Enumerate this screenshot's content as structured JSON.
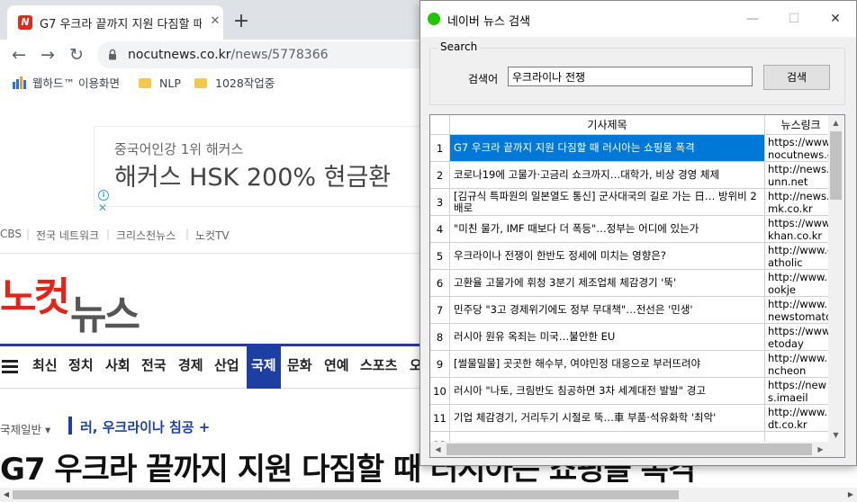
{
  "browser": {
    "tab_title": "G7 우크라 끝까지 지원 다짐할 때",
    "tab_close": "✕",
    "new_tab": "+",
    "favicon_letter": "N",
    "url_host": "nocutnews.co.kr",
    "url_path": "/news/5778366",
    "nav": {
      "back": "←",
      "forward": "→",
      "reload": "↻"
    },
    "bookmarks": [
      {
        "label": "웹하드™ 이용화면",
        "icon": "webhard-icon"
      },
      {
        "label": "NLP",
        "icon": "folder-icon"
      },
      {
        "label": "1028작업중",
        "icon": "folder-icon"
      }
    ]
  },
  "page": {
    "ad_line1": "중국어인강 1위 해커스",
    "ad_line2": "해커스 HSK 200% 현금환",
    "ad_info": "i",
    "ad_close": "✕",
    "topnav": [
      "CBS",
      "전국 네트워크",
      "크리스천뉴스",
      "노컷TV"
    ],
    "logo_part1": "노컷",
    "logo_part2": "뉴스",
    "menu": [
      "최신",
      "정치",
      "사회",
      "전국",
      "경제",
      "산업",
      "국제",
      "문화",
      "연예",
      "스포츠",
      "오"
    ],
    "menu_active": "국제",
    "breadcrumb_section": "국제일반 ▾",
    "breadcrumb_topic": "러, 우크라이나 침공 +",
    "headline": "G7 우크라 끝까지 지원 다짐할 때 러시아는 쇼핑몰 폭격"
  },
  "dialog": {
    "title": "네이버 뉴스 검색",
    "window_buttons": {
      "minimize": "—",
      "maximize": "☐",
      "close": "✕"
    },
    "group_label": "Search",
    "search_label": "검색어",
    "search_value": "우크라이나 전쟁",
    "search_button": "검색",
    "grid": {
      "columns": [
        "기사제목",
        "뉴스링크"
      ],
      "rows": [
        {
          "num": "1",
          "title": "G7 우크라 끝까지 지원 다짐할 때 러시아는 쇼핑몰 폭격",
          "link": "https://www.nocutnews.co.kr",
          "selected": true
        },
        {
          "num": "2",
          "title": "코로나19에 고물가·고금리 쇼크까지…대학가, 비상 경영 체제",
          "link": "http://news.unn.net",
          "selected": false
        },
        {
          "num": "3",
          "title": "[김규식 특파원의 일본열도 통신] 군사대국의 길로 가는 日… 방위비 2배로",
          "link": "http://news.mk.co.kr",
          "selected": false
        },
        {
          "num": "4",
          "title": "\"미친 물가, IMF 때보다 더 폭등\"…정부는 어디에 있는가",
          "link": "https://www.khan.co.kr",
          "selected": false
        },
        {
          "num": "5",
          "title": "우크라이나 전쟁이 한반도 정세에 미치는 영향은?",
          "link": "http://www.catholic",
          "selected": false
        },
        {
          "num": "6",
          "title": "고환율 고물가에 휘청 3분기 제조업체 체감경기 '뚝'",
          "link": "http://www.kookje",
          "selected": false
        },
        {
          "num": "7",
          "title": "민주당 \"3고 경제위기에도 정부 무대책\"…전선은 '민생'",
          "link": "http://www.newstomato",
          "selected": false
        },
        {
          "num": "8",
          "title": "러시아 원유 옥죄는 미국…불안한 EU",
          "link": "https://www.etoday",
          "selected": false
        },
        {
          "num": "9",
          "title": "[썰물밀물] 곳곳한 해수부, 여야민정 대응으로 부러뜨려야",
          "link": "http://www.incheon",
          "selected": false
        },
        {
          "num": "10",
          "title": "러시아 \"나토, 크림반도 침공하면 3차 세계대전 발발\" 경고",
          "link": "https://news.imaeil",
          "selected": false
        },
        {
          "num": "11",
          "title": "기업 체감경기, 거리두기 시절로 뚝…車 부품·석유화학 '최악'",
          "link": "http://www.dt.co.kr",
          "selected": false
        },
        {
          "num": "12",
          "title": "",
          "link": "",
          "selected": false
        }
      ]
    }
  }
}
